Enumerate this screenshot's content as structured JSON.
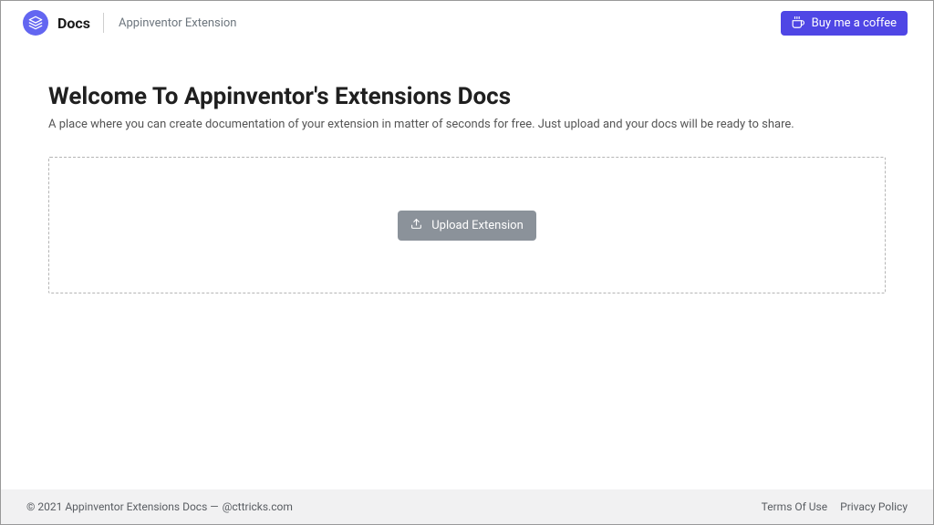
{
  "header": {
    "brand": "Docs",
    "sub_brand": "Appinventor Extension",
    "coffee_label": "Buy me a coffee"
  },
  "hero": {
    "title": "Welcome To Appinventor's Extensions Docs",
    "subtitle": "A place where you can create documentation of your extension in matter of seconds for free. Just upload and your docs will be ready to share."
  },
  "upload": {
    "button_label": "Upload Extension"
  },
  "footer": {
    "copyright": "© 2021 Appinventor Extensions Docs —",
    "author": "@cttricks.com",
    "links": {
      "terms": "Terms Of Use",
      "privacy": "Privacy Policy"
    }
  },
  "colors": {
    "accent": "#4f46e5",
    "muted": "#8b929a"
  }
}
